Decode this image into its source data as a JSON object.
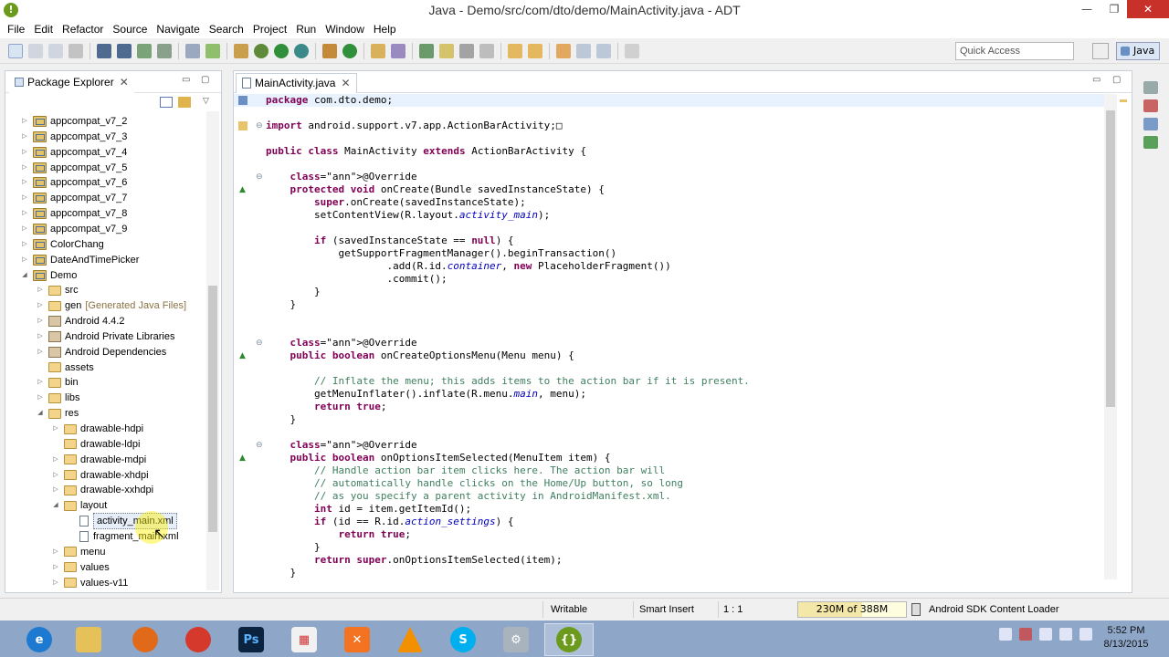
{
  "window": {
    "title": "Java - Demo/src/com/dto/demo/MainActivity.java - ADT",
    "app_icon": "adt-icon",
    "minimize": "—",
    "restore": "❐",
    "close": "✕"
  },
  "menu": [
    "File",
    "Edit",
    "Refactor",
    "Source",
    "Navigate",
    "Search",
    "Project",
    "Run",
    "Window",
    "Help"
  ],
  "toolbar": {
    "quick_access_placeholder": "Quick Access",
    "perspective": "Java"
  },
  "package_explorer": {
    "title": "Package Explorer",
    "items": [
      {
        "label": "appcompat_v7_2",
        "type": "project",
        "expanded": false,
        "level": 0
      },
      {
        "label": "appcompat_v7_3",
        "type": "project",
        "expanded": false,
        "level": 0
      },
      {
        "label": "appcompat_v7_4",
        "type": "project",
        "expanded": false,
        "level": 0
      },
      {
        "label": "appcompat_v7_5",
        "type": "project",
        "expanded": false,
        "level": 0
      },
      {
        "label": "appcompat_v7_6",
        "type": "project",
        "expanded": false,
        "level": 0
      },
      {
        "label": "appcompat_v7_7",
        "type": "project",
        "expanded": false,
        "level": 0
      },
      {
        "label": "appcompat_v7_8",
        "type": "project",
        "expanded": false,
        "level": 0
      },
      {
        "label": "appcompat_v7_9",
        "type": "project",
        "expanded": false,
        "level": 0
      },
      {
        "label": "ColorChang",
        "type": "project",
        "expanded": false,
        "level": 0
      },
      {
        "label": "DateAndTimePicker",
        "type": "project",
        "expanded": false,
        "level": 0
      },
      {
        "label": "Demo",
        "type": "project",
        "expanded": true,
        "level": 0
      },
      {
        "label": "src",
        "type": "folder",
        "expanded": false,
        "level": 1
      },
      {
        "label": "gen",
        "decoration": "[Generated Java Files]",
        "type": "folder",
        "expanded": false,
        "level": 1
      },
      {
        "label": "Android 4.4.2",
        "type": "lib",
        "expanded": false,
        "level": 1
      },
      {
        "label": "Android Private Libraries",
        "type": "lib",
        "expanded": false,
        "level": 1
      },
      {
        "label": "Android Dependencies",
        "type": "lib",
        "expanded": false,
        "level": 1
      },
      {
        "label": "assets",
        "type": "folder",
        "expanded": null,
        "level": 1
      },
      {
        "label": "bin",
        "type": "folder",
        "expanded": false,
        "level": 1
      },
      {
        "label": "libs",
        "type": "folder",
        "expanded": false,
        "level": 1
      },
      {
        "label": "res",
        "type": "folder",
        "expanded": true,
        "level": 1
      },
      {
        "label": "drawable-hdpi",
        "type": "folder",
        "expanded": false,
        "level": 2
      },
      {
        "label": "drawable-ldpi",
        "type": "folder",
        "expanded": null,
        "level": 2
      },
      {
        "label": "drawable-mdpi",
        "type": "folder",
        "expanded": false,
        "level": 2
      },
      {
        "label": "drawable-xhdpi",
        "type": "folder",
        "expanded": false,
        "level": 2
      },
      {
        "label": "drawable-xxhdpi",
        "type": "folder",
        "expanded": false,
        "level": 2
      },
      {
        "label": "layout",
        "type": "folder",
        "expanded": true,
        "level": 2
      },
      {
        "label": "activity_main.xml",
        "type": "xml",
        "expanded": null,
        "level": 3,
        "selected": true
      },
      {
        "label": "fragment_main.xml",
        "type": "xml",
        "expanded": null,
        "level": 3
      },
      {
        "label": "menu",
        "type": "folder",
        "expanded": false,
        "level": 2
      },
      {
        "label": "values",
        "type": "folder",
        "expanded": false,
        "level": 2
      },
      {
        "label": "values-v11",
        "type": "folder",
        "expanded": false,
        "level": 2
      }
    ]
  },
  "editor": {
    "tab_label": "MainActivity.java",
    "lines": [
      "package com.dto.demo;",
      "",
      "import android.support.v7.app.ActionBarActivity;□",
      "",
      "public class MainActivity extends ActionBarActivity {",
      "",
      "    @Override",
      "    protected void onCreate(Bundle savedInstanceState) {",
      "        super.onCreate(savedInstanceState);",
      "        setContentView(R.layout.activity_main);",
      "",
      "        if (savedInstanceState == null) {",
      "            getSupportFragmentManager().beginTransaction()",
      "                    .add(R.id.container, new PlaceholderFragment())",
      "                    .commit();",
      "        }",
      "    }",
      "",
      "",
      "    @Override",
      "    public boolean onCreateOptionsMenu(Menu menu) {",
      "",
      "        // Inflate the menu; this adds items to the action bar if it is present.",
      "        getMenuInflater().inflate(R.menu.main, menu);",
      "        return true;",
      "    }",
      "",
      "    @Override",
      "    public boolean onOptionsItemSelected(MenuItem item) {",
      "        // Handle action bar item clicks here. The action bar will",
      "        // automatically handle clicks on the Home/Up button, so long",
      "        // as you specify a parent activity in AndroidManifest.xml.",
      "        int id = item.getItemId();",
      "        if (id == R.id.action_settings) {",
      "            return true;",
      "        }",
      "        return super.onOptionsItemSelected(item);",
      "    }"
    ]
  },
  "status": {
    "writable": "Writable",
    "insert_mode": "Smart Insert",
    "position": "1 : 1",
    "heap": "230M of 388M",
    "heap_fraction": 0.593,
    "progress": "Android SDK Content Loader"
  },
  "taskbar": {
    "apps": [
      "internet-explorer-icon",
      "file-explorer-icon",
      "firefox-icon",
      "chrome-icon",
      "photoshop-icon",
      "calculator-icon",
      "xampp-icon",
      "vlc-icon",
      "skype-icon",
      "settings-icon",
      "adt-icon"
    ],
    "time": "5:52 PM",
    "date": "8/13/2015"
  }
}
